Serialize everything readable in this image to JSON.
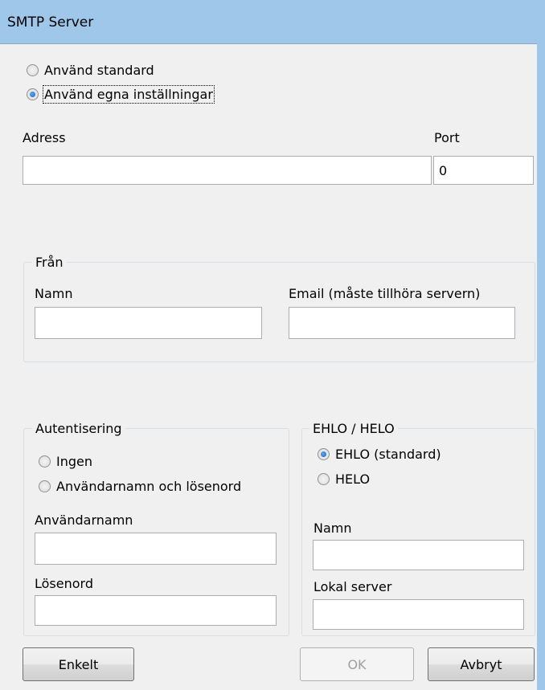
{
  "window": {
    "title": "SMTP Server"
  },
  "server_mode": {
    "options": [
      {
        "label": "Använd standard",
        "checked": false
      },
      {
        "label": "Använd egna inställningar",
        "checked": true
      }
    ]
  },
  "server": {
    "address_label": "Adress",
    "address_value": "",
    "port_label": "Port",
    "port_value": "0"
  },
  "from": {
    "group_title": "Från",
    "name_label": "Namn",
    "name_value": "",
    "email_label": "Email (måste tillhöra servern)",
    "email_value": ""
  },
  "auth": {
    "group_title": "Autentisering",
    "options": [
      {
        "label": "Ingen",
        "checked": false
      },
      {
        "label": "Användarnamn och lösenord",
        "checked": false
      }
    ],
    "username_label": "Användarnamn",
    "username_value": "",
    "password_label": "Lösenord",
    "password_value": ""
  },
  "ehlo": {
    "group_title": "EHLO / HELO",
    "options": [
      {
        "label": "EHLO (standard)",
        "checked": true
      },
      {
        "label": "HELO",
        "checked": false
      }
    ],
    "name_label": "Namn",
    "name_value": "",
    "local_server_label": "Lokal server",
    "local_server_value": ""
  },
  "buttons": {
    "simple": "Enkelt",
    "ok": "OK",
    "cancel": "Avbryt"
  }
}
